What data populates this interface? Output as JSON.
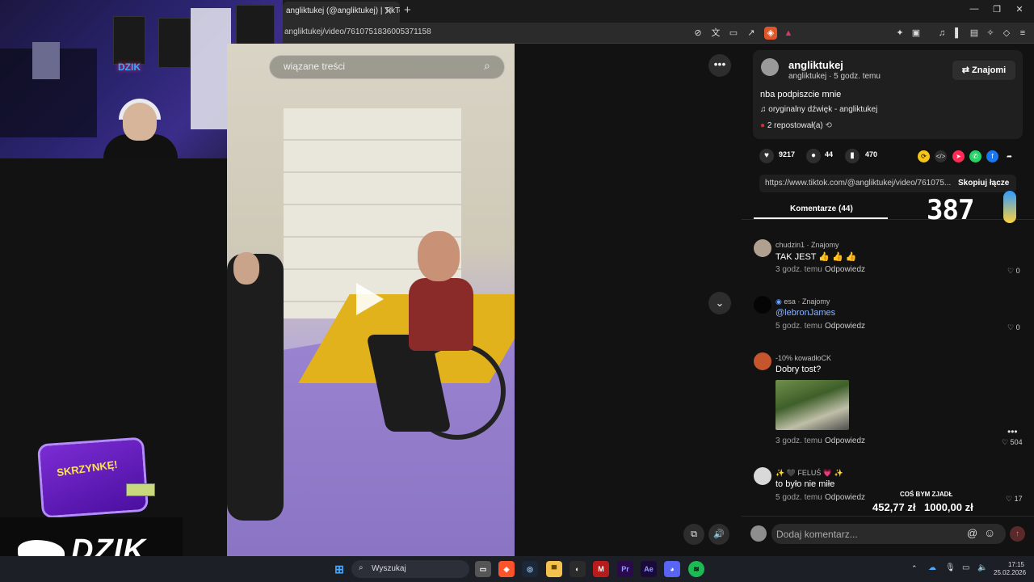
{
  "browser": {
    "tab_title": "angliktukej (@angliktukej) | TikTo",
    "url": "angliktukej/video/7610751836005371158",
    "close_tab": "✕",
    "new_tab": "+"
  },
  "video": {
    "search_placeholder": "wiązane treści"
  },
  "stream": {
    "cam_logo": "DZIK",
    "promo_text": "SKRZYNKĘ!",
    "dzik_brand": "DZIK",
    "counter": "387",
    "caption_small": "COŚ BYM ZJADŁ",
    "price_left": "452,77 zł",
    "price_right": "1000,00 zł"
  },
  "post": {
    "author": "angliktukej",
    "meta": "angliktukej · 5 godz. temu",
    "friends_label": "Znajomi",
    "description": "nba podpiszcie mnie",
    "music": "oryginalny dźwięk - angliktukej",
    "reposts": "2 repostował(a)",
    "likes": "9217",
    "comments_count": "44",
    "saves": "470",
    "link": "https://www.tiktok.com/@angliktukej/video/761075...",
    "copy_link": "Skopiuj łącze",
    "comments_tab": "Komentarze (44)"
  },
  "comments": [
    {
      "user": "chudzin1 · Znajomy",
      "text": "TAK JEST 👍 👍 👍",
      "time": "3 godz. temu",
      "reply": "Odpowiedz",
      "likes": "0"
    },
    {
      "user": "esa · Znajomy",
      "text": "@lebronJames",
      "time": "5 godz. temu",
      "reply": "Odpowiedz",
      "likes": "0"
    },
    {
      "user": "-10% kowadłoCK",
      "text": "Dobry tost?",
      "time": "3 godz. temu",
      "reply": "Odpowiedz",
      "likes": "504"
    },
    {
      "user": "✨ 🖤 FELUŚ 💗 ✨",
      "text": "to było nie miłe",
      "time": "5 godz. temu",
      "reply": "Odpowiedz",
      "likes": "17"
    }
  ],
  "comment_input": {
    "placeholder": "Dodaj komentarz..."
  },
  "taskbar": {
    "search_label": "Wyszukaj",
    "time": "17:15",
    "date": "25.02.2026"
  },
  "colors": {
    "accent_red": "#fe2c55",
    "panel_bg": "#121212",
    "card_bg": "#1f1f1f",
    "mention_blue": "#8ab4ff"
  }
}
